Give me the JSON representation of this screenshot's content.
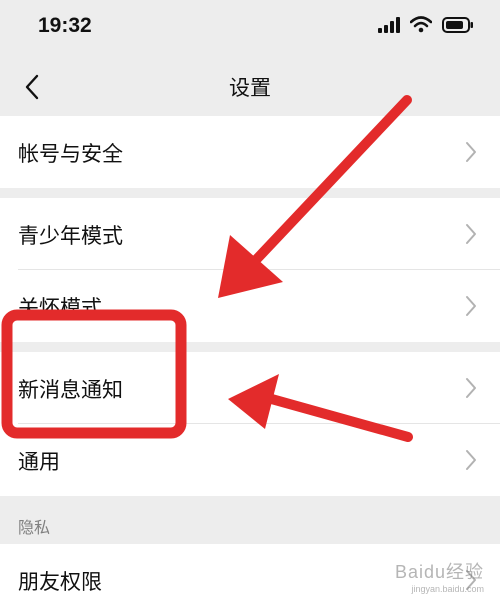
{
  "status_bar": {
    "time": "19:32"
  },
  "nav": {
    "title": "设置",
    "back_icon": "chevron-left-icon"
  },
  "groups": [
    {
      "items": [
        {
          "label": "帐号与安全"
        }
      ]
    },
    {
      "items": [
        {
          "label": "青少年模式"
        },
        {
          "label": "关怀模式"
        }
      ]
    },
    {
      "items": [
        {
          "label": "新消息通知"
        },
        {
          "label": "通用"
        }
      ]
    }
  ],
  "privacy": {
    "section_label": "隐私",
    "items": [
      {
        "label": "朋友权限"
      }
    ]
  },
  "annotation": {
    "highlight_color": "#e32b2b"
  },
  "watermark": {
    "text": "Baidu经验",
    "sub": "jingyan.baidu.com"
  },
  "colors": {
    "background": "#ededed",
    "row": "#ffffff",
    "text": "#111111",
    "secondary": "#808080"
  }
}
